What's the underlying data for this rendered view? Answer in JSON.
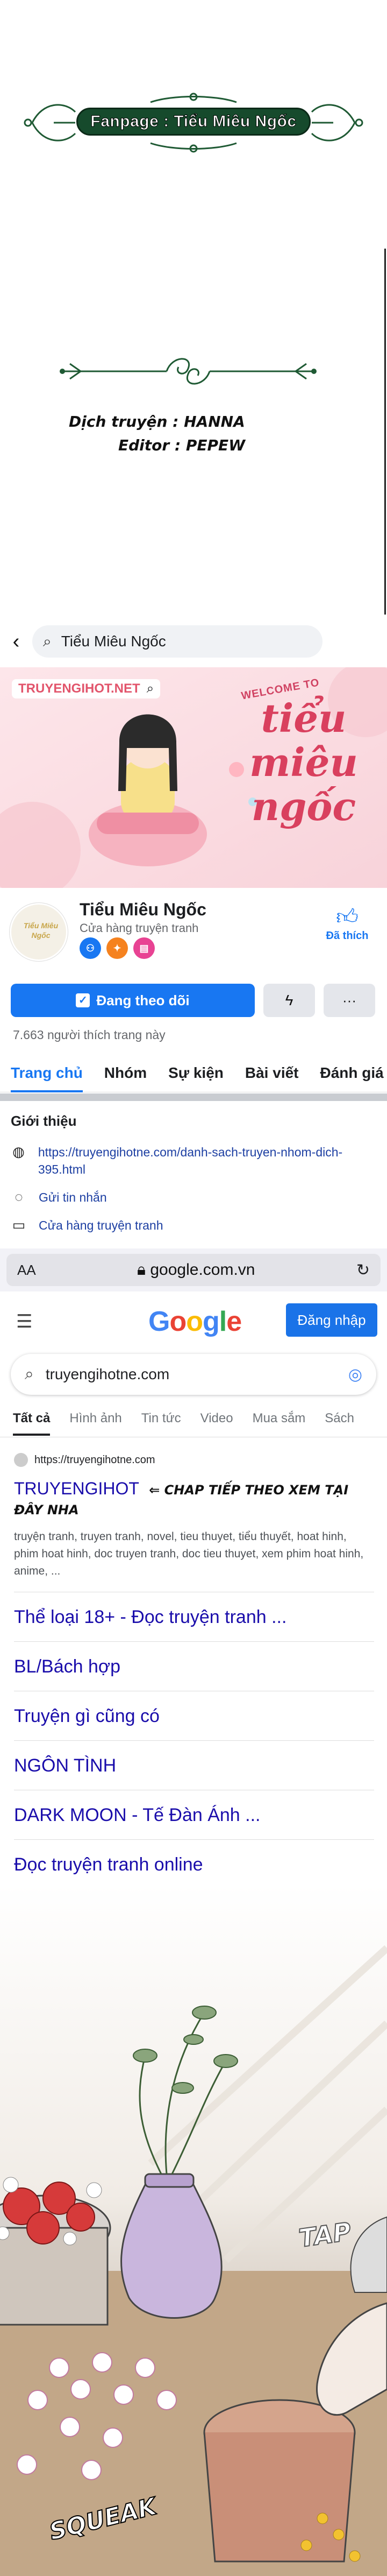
{
  "intro": {
    "fanpage_label": "Fanpage : Tiểu Miêu Ngốc",
    "translator_line": "Dịch truyện : HANNA",
    "editor_line": "Editor : PEPEW"
  },
  "facebook": {
    "search_text": "Tiểu Miêu Ngốc",
    "cover": {
      "site_watermark": "TRUYENGIHOT.NET",
      "welcome_text": "WELCOME TO",
      "title_line1": "tiểu",
      "title_line2": "miêu",
      "title_line3": "ngốc"
    },
    "avatar_text": "Tiểu Miêu Ngốc",
    "page_name": "Tiểu Miêu Ngốc",
    "category": "Cửa hàng truyện tranh",
    "like_label": "Đã thích",
    "follow_label": "Đang theo dõi",
    "more_label": "···",
    "likes_count": "7.663 người thích trang này",
    "tabs": [
      "Trang chủ",
      "Nhóm",
      "Sự kiện",
      "Bài viết",
      "Đánh giá"
    ],
    "intro_heading": "Giới thiệu",
    "intro_link": "https://truyengihotne.com/danh-sach-truyen-nhom-dich-395.html",
    "intro_message": "Gửi tin nhắn",
    "intro_category": "Cửa hàng truyện tranh",
    "colors": {
      "accent": "#1877f2"
    }
  },
  "safari": {
    "aa_label": "AA",
    "address": "google.com.vn",
    "lock_icon": "lock-icon",
    "reload_icon": "reload-icon"
  },
  "google": {
    "logo_letters": [
      "G",
      "o",
      "o",
      "g",
      "l",
      "e"
    ],
    "signin_label": "Đăng nhập",
    "query": "truyengihotne.com",
    "tabs": [
      "Tất cả",
      "Hình ảnh",
      "Tin tức",
      "Video",
      "Mua sắm",
      "Sách"
    ],
    "result": {
      "site_url": "https://truyengihotne.com",
      "title": "TRUYENGIHOT",
      "cta": "⇐ CHAP TIẾP THEO XEM TẠI ĐÂY NHA",
      "snippet": "truyện tranh, truyen tranh, novel, tieu thuyet, tiểu thuyết, hoat hinh, phim hoat hinh, doc truyen tranh, doc tieu thuyet, xem phim hoat hinh, anime, ...",
      "sublinks": [
        "Thể loại 18+ - Đọc truyện tranh ...",
        "BL/Bách hợp",
        "Truyện gì cũng có",
        "NGÔN TÌNH",
        "DARK MOON - Tế Đàn Ánh ...",
        "Đọc truyện tranh online"
      ]
    }
  },
  "comic": {
    "sfx_tap": "TAP",
    "sfx_squeak": "SQUEAK"
  }
}
